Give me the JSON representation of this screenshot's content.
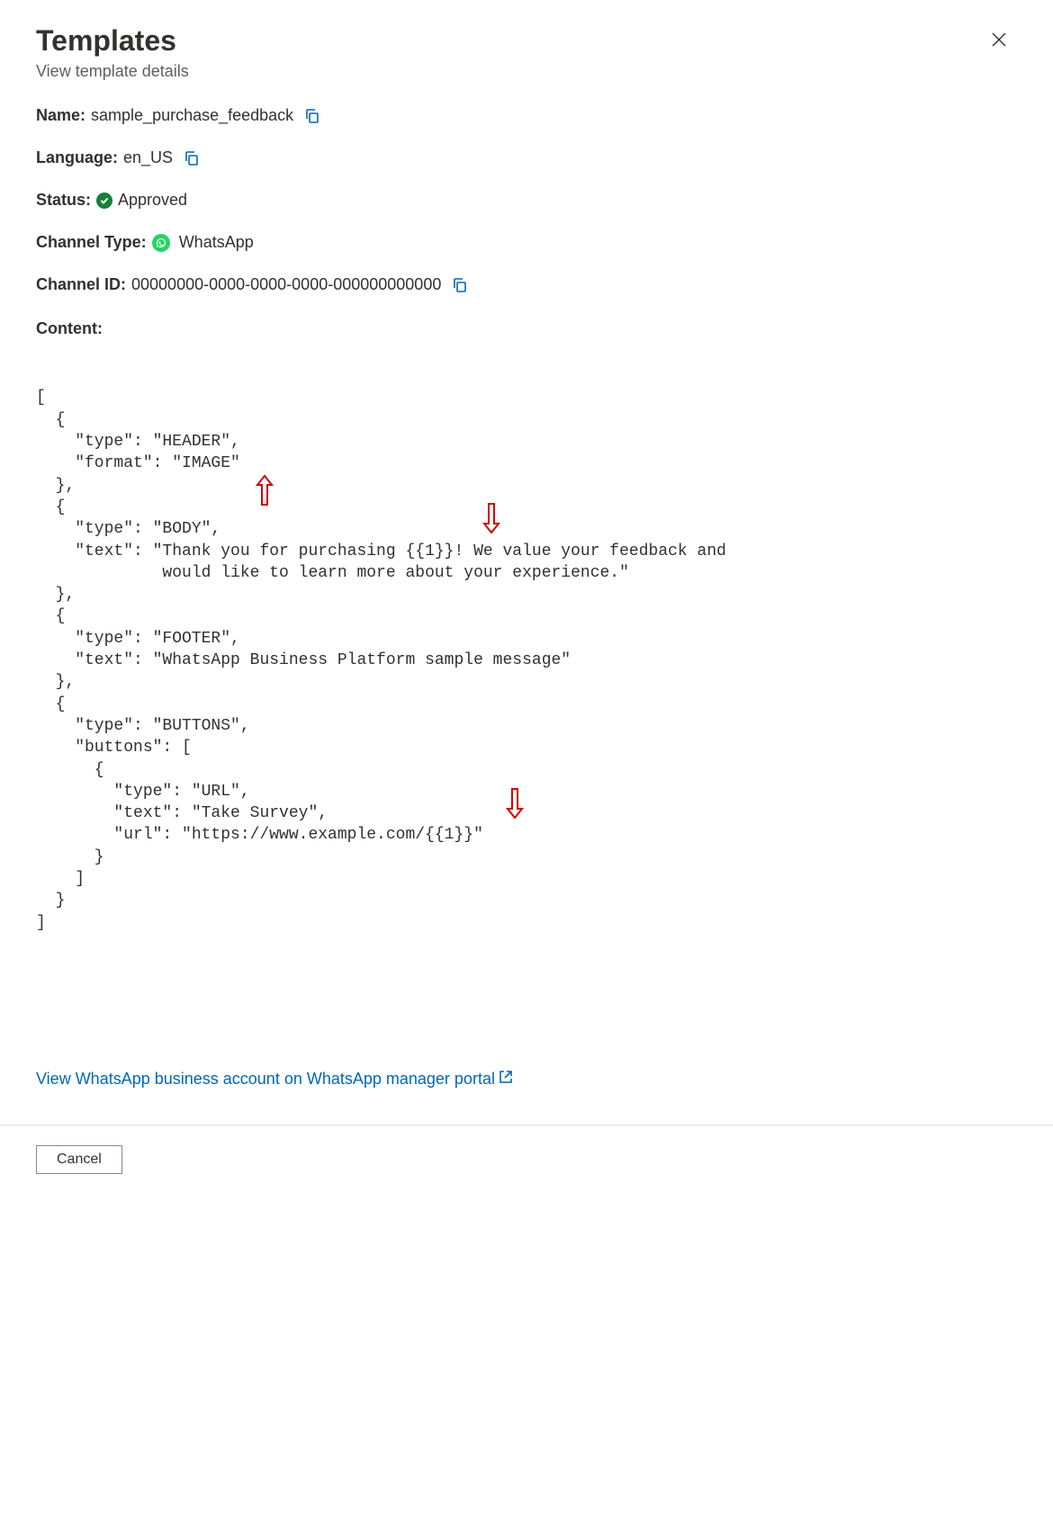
{
  "header": {
    "title": "Templates",
    "subtitle": "View template details"
  },
  "fields": {
    "name_label": "Name:",
    "name_value": "sample_purchase_feedback",
    "language_label": "Language:",
    "language_value": "en_US",
    "status_label": "Status:",
    "status_value": "Approved",
    "channel_type_label": "Channel Type:",
    "channel_type_value": "WhatsApp",
    "channel_id_label": "Channel ID:",
    "channel_id_value": "00000000-0000-0000-0000-000000000000",
    "content_label": "Content:"
  },
  "content_json": "[\n  {\n    \"type\": \"HEADER\",\n    \"format\": \"IMAGE\"\n  },\n  {\n    \"type\": \"BODY\",\n    \"text\": \"Thank you for purchasing {{1}}! We value your feedback and\n             would like to learn more about your experience.\"\n  },\n  {\n    \"type\": \"FOOTER\",\n    \"text\": \"WhatsApp Business Platform sample message\"\n  },\n  {\n    \"type\": \"BUTTONS\",\n    \"buttons\": [\n      {\n        \"type\": \"URL\",\n        \"text\": \"Take Survey\",\n        \"url\": \"https://www.example.com/{{1}}\"\n      }\n    ]\n  }\n]",
  "link": {
    "text": "View WhatsApp business account on WhatsApp manager portal"
  },
  "footer": {
    "cancel_label": "Cancel"
  },
  "icons": {
    "copy": "copy-icon",
    "close": "close-icon",
    "status_approved": "check-circle-icon",
    "whatsapp": "whatsapp-icon",
    "external_link": "external-link-icon"
  },
  "colors": {
    "link": "#0067b8",
    "status_green": "#188038",
    "whatsapp_green": "#25d366",
    "annotation_red": "#d00000"
  }
}
